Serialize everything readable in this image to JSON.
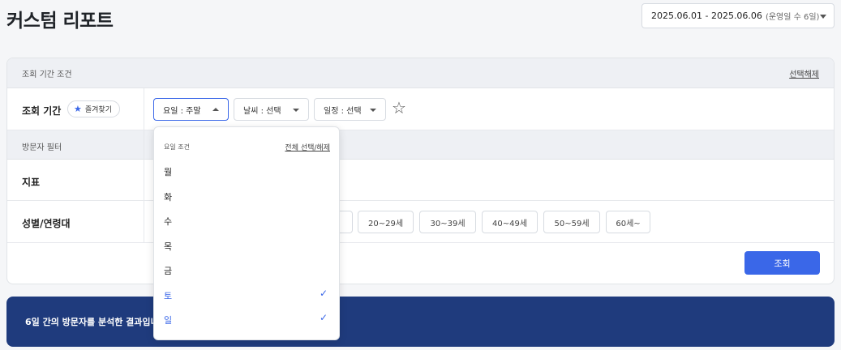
{
  "page": {
    "title": "커스텀 리포트"
  },
  "date_range": {
    "value": "2025.06.01 - 2025.06.06",
    "sub": "(운영일 수 6일)"
  },
  "conditions": {
    "header": "조회 기간 조건",
    "clear_label": "선택해제",
    "period_label": "조회 기간",
    "favorite_label": "즐겨찾기",
    "day_select": "요일 : 주말",
    "weather_select": "날씨 : 선택",
    "schedule_select": "일정 : 선택"
  },
  "filter": {
    "header": "방문자 필터",
    "metric_label": "지표",
    "gender_age_label": "성별/연령대",
    "age_chips": [
      "20~29세",
      "30~39세",
      "40~49세",
      "50~59세",
      "60세~"
    ]
  },
  "search_button": "조회",
  "banner": {
    "text": "6일 간의 방문자를 분석한 결과입니"
  },
  "dropdown": {
    "title": "요일 조건",
    "select_all": "전체 선택/해제",
    "items": [
      {
        "label": "월",
        "checked": false
      },
      {
        "label": "화",
        "checked": false
      },
      {
        "label": "수",
        "checked": false
      },
      {
        "label": "목",
        "checked": false
      },
      {
        "label": "금",
        "checked": false
      },
      {
        "label": "토",
        "checked": true
      },
      {
        "label": "일",
        "checked": true
      }
    ]
  },
  "colors": {
    "accent": "#3a67e8",
    "banner": "#1f3b7d",
    "header_bg": "#eef0f4"
  }
}
